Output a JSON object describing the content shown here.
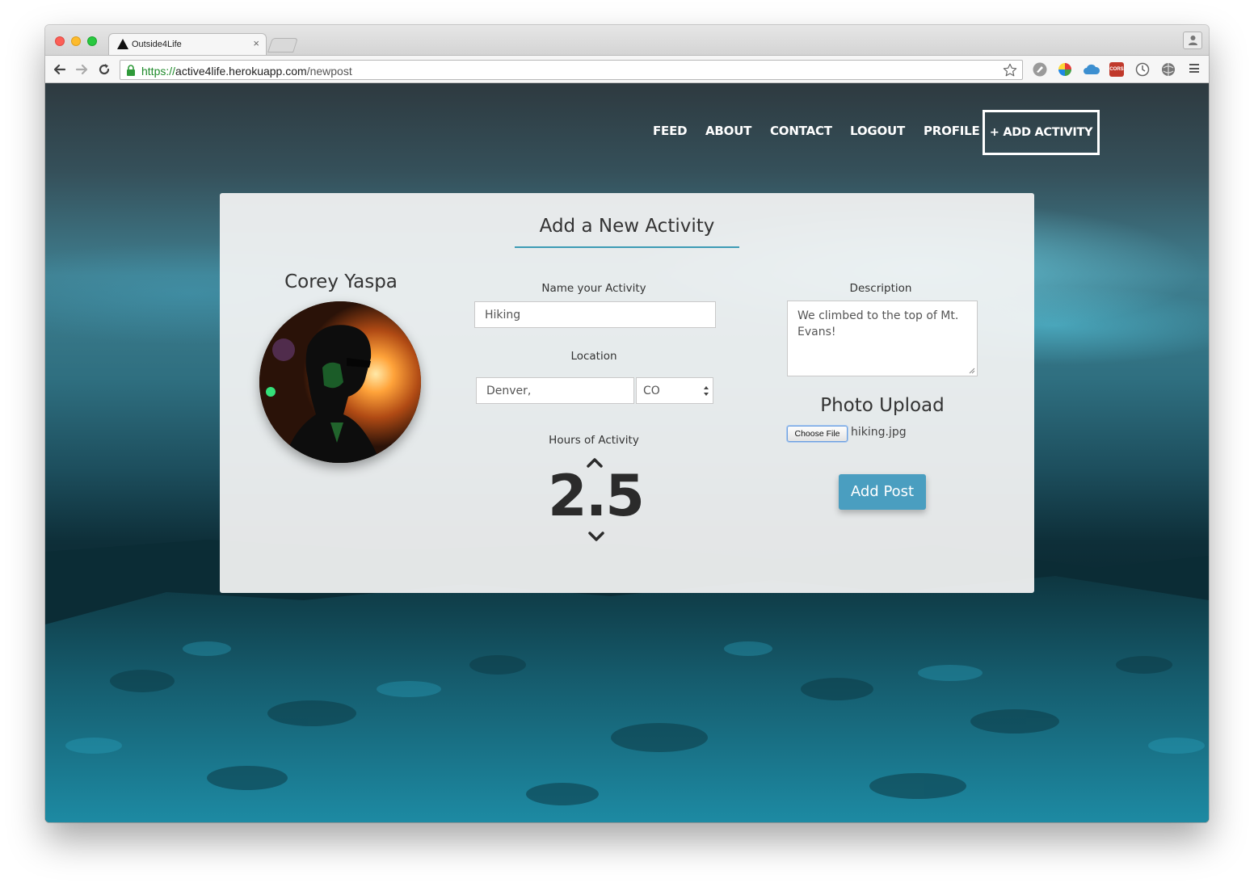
{
  "browser": {
    "tab_title": "Outside4Life",
    "tab_close": "×",
    "url_scheme": "https://",
    "url_host": "active4life.herokuapp.com",
    "url_path": "/newpost",
    "extensions": [
      "feedly-icon",
      "color-wheel-icon",
      "cloud-icon",
      "cors-icon",
      "clock-icon",
      "globe-icon"
    ],
    "cors_label": "CORS"
  },
  "nav": {
    "feed": "FEED",
    "about": "ABOUT",
    "contact": "CONTACT",
    "logout": "LOGOUT",
    "profile": "PROFILE",
    "add_activity": "+ ADD ACTIVITY"
  },
  "form": {
    "title": "Add a New Activity",
    "user_name": "Corey Yaspa",
    "activity_label": "Name your Activity",
    "activity_value": "Hiking",
    "location_label": "Location",
    "city_value": "Denver,",
    "state_value": "CO",
    "hours_label": "Hours of Activity",
    "hours_value": "2.5",
    "description_label": "Description",
    "description_value": "We climbed to the top of Mt. Evans!",
    "photo_heading": "Photo Upload",
    "choose_file_label": "Choose File",
    "file_name": "hiking.jpg",
    "submit_label": "Add Post"
  },
  "colors": {
    "accent": "#4a9ec0",
    "underline": "#3d9bb5",
    "secure_green": "#1e8a2a"
  }
}
